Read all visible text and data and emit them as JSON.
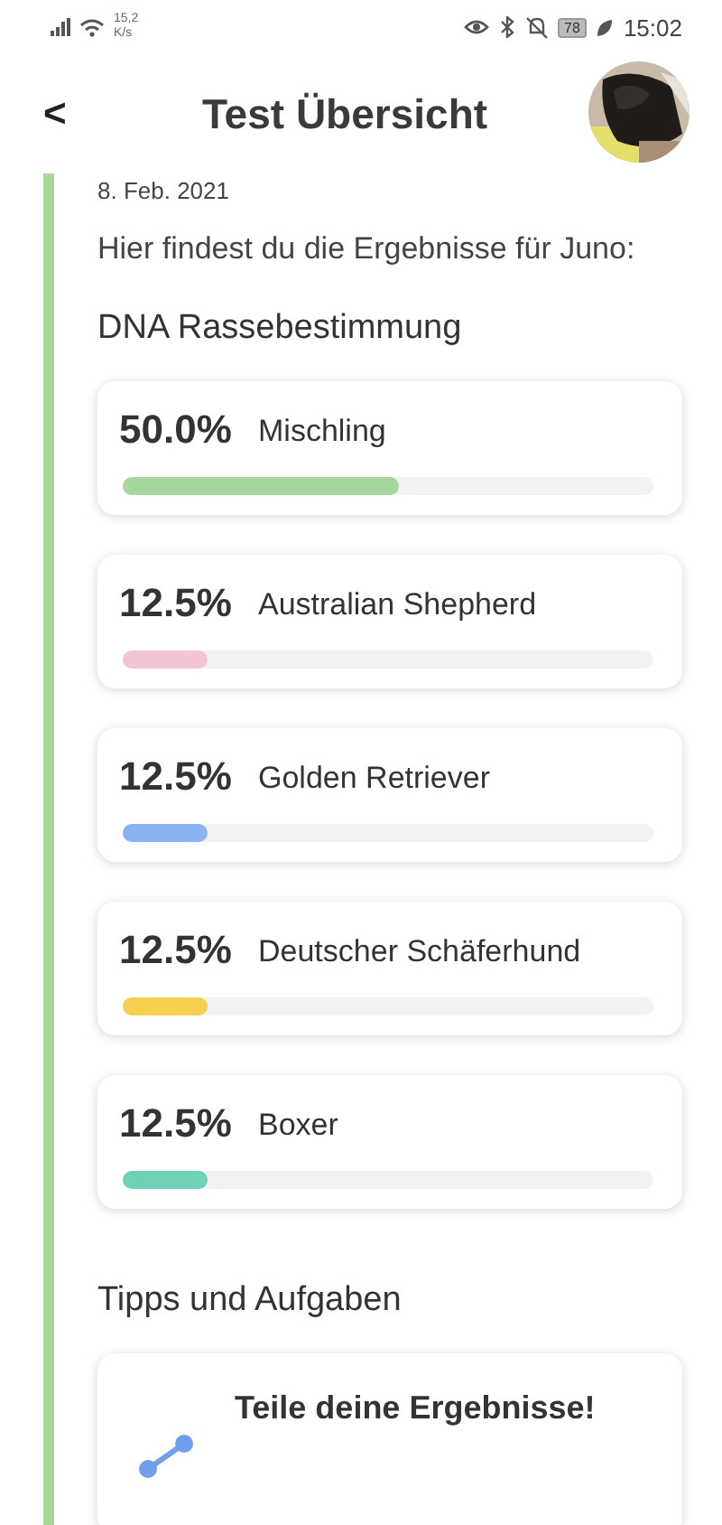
{
  "status_bar": {
    "speed": "15,2",
    "speed_unit": "K/s",
    "battery": "78",
    "time": "15:02"
  },
  "header": {
    "back": "<",
    "title": "Test Übersicht"
  },
  "date": "8. Feb. 2021",
  "intro": "Hier findest du die Ergebnisse für Juno:",
  "breed_section": {
    "title": "DNA Rassebestimmung",
    "results": [
      {
        "percent": "50.0%",
        "name": "Mischling",
        "level": 0.52,
        "color": "#a6d69b"
      },
      {
        "percent": "12.5%",
        "name": "Australian Shepherd",
        "level": 0.16,
        "color": "#f3c3d6"
      },
      {
        "percent": "12.5%",
        "name": "Golden Retriever",
        "level": 0.16,
        "color": "#89b3f2"
      },
      {
        "percent": "12.5%",
        "name": "Deutscher Schäferhund",
        "level": 0.16,
        "color": "#f6cf4e"
      },
      {
        "percent": "12.5%",
        "name": "Boxer",
        "level": 0.16,
        "color": "#6fd2b6"
      }
    ]
  },
  "tips_section": {
    "title": "Tipps und Aufgaben",
    "tips": [
      {
        "title": "Teile deine Ergebnisse!"
      }
    ]
  }
}
